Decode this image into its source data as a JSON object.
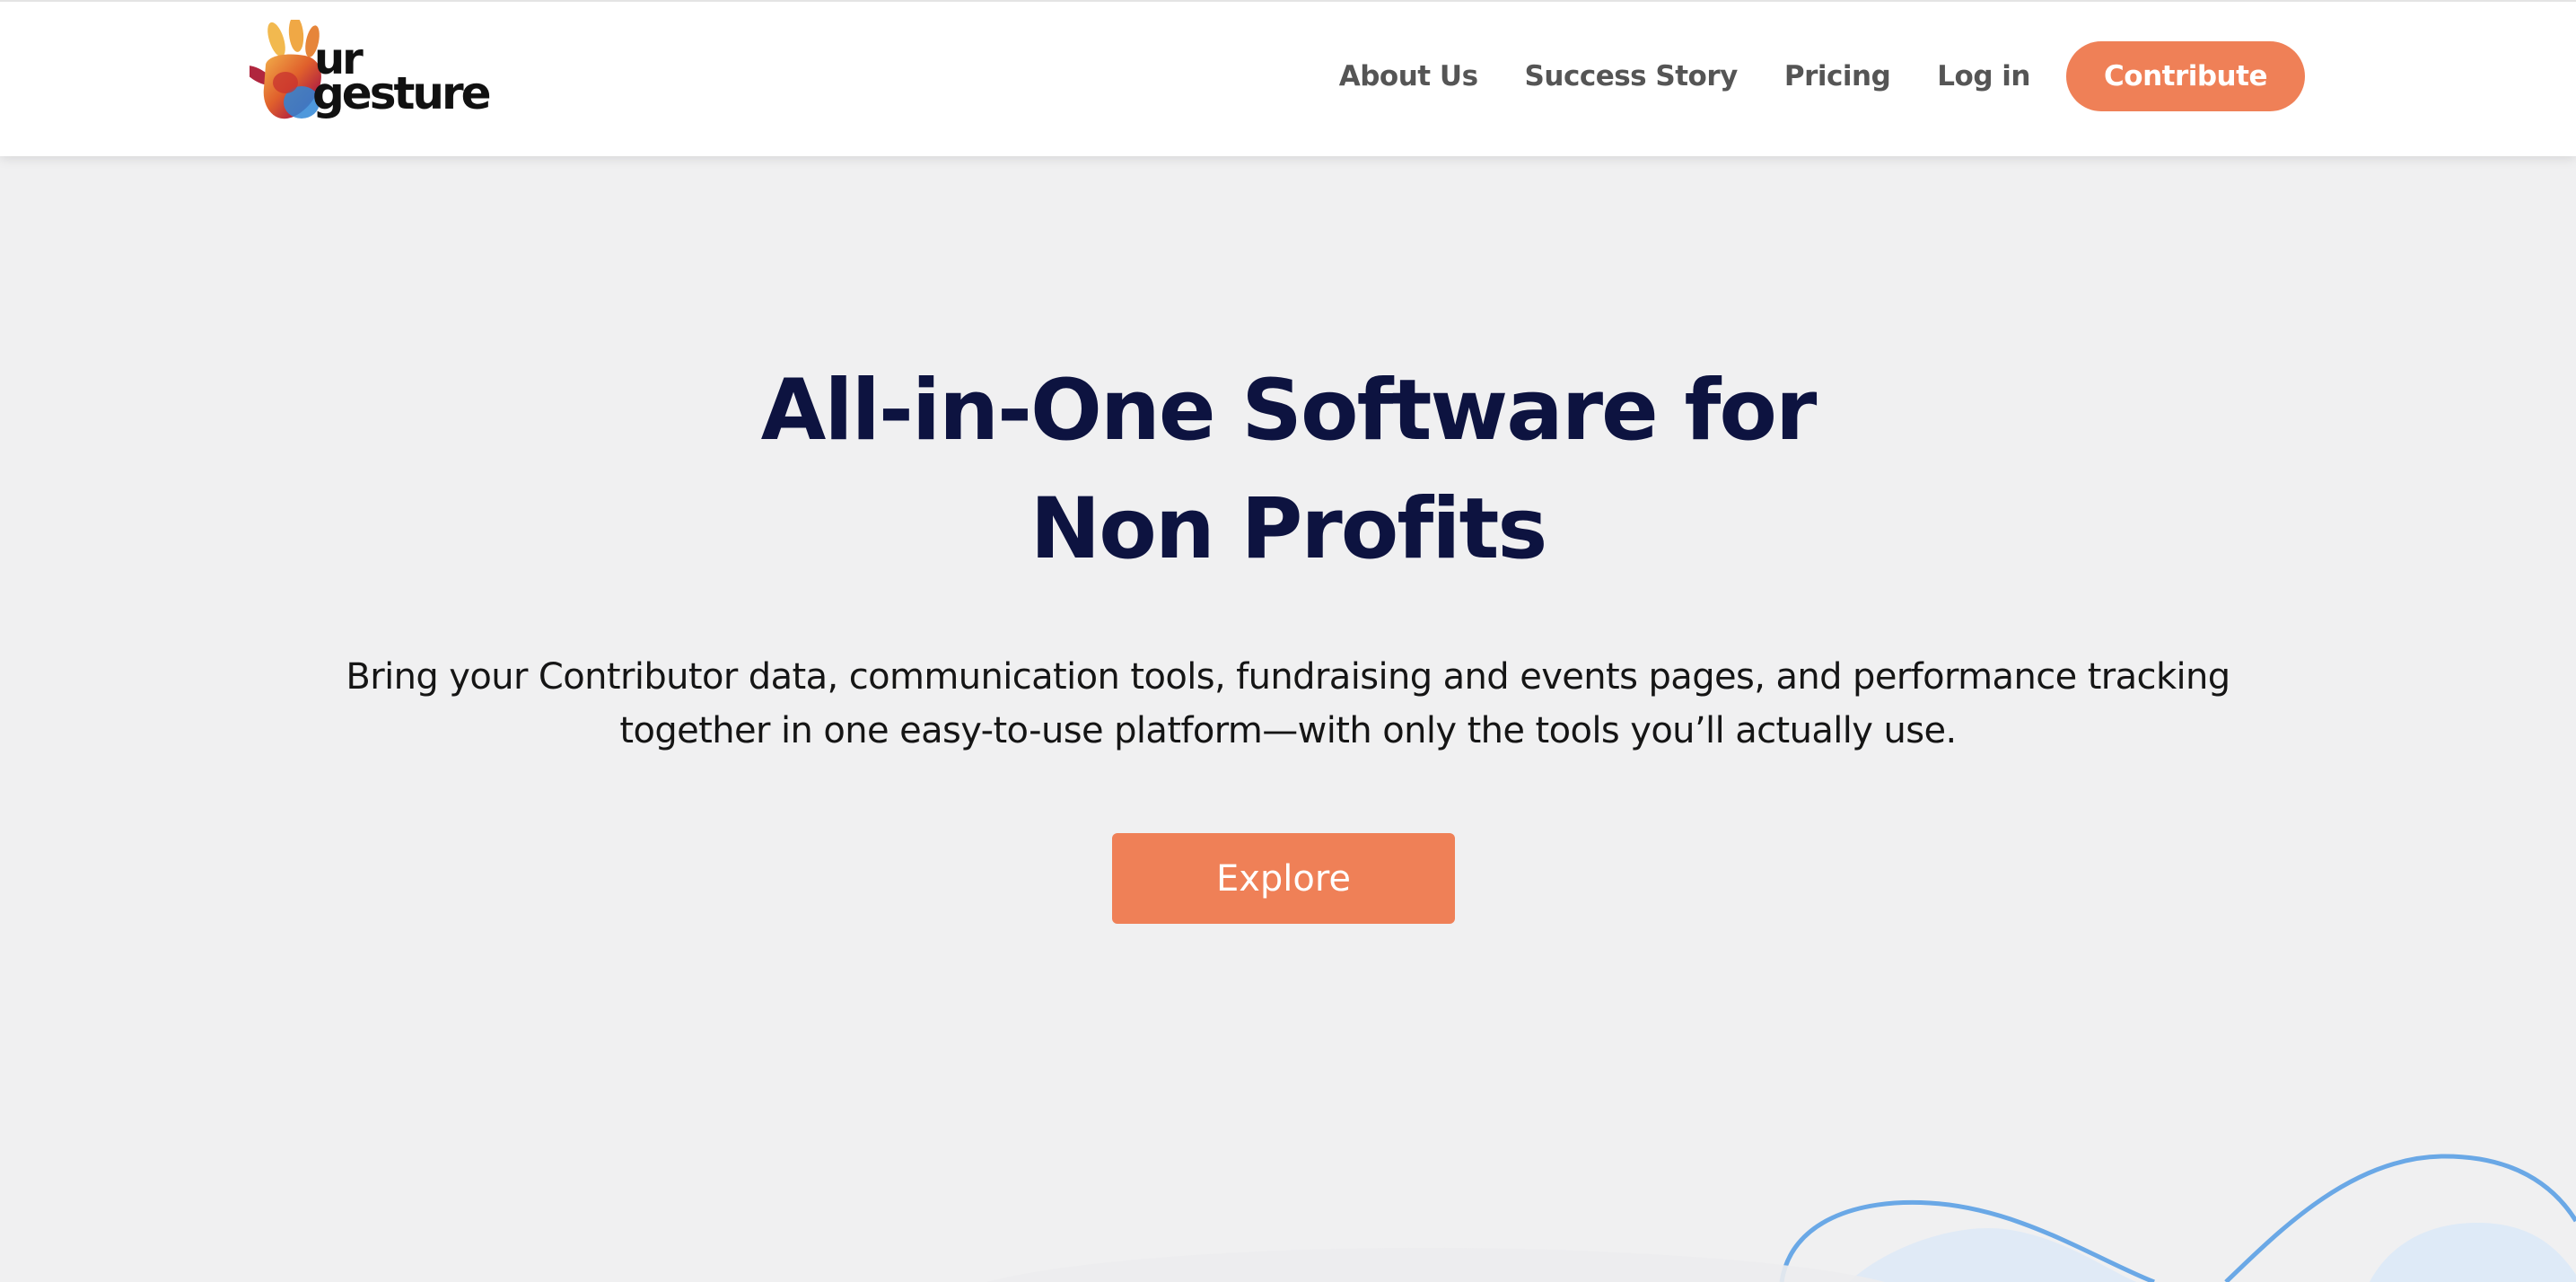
{
  "brand": {
    "logo_line1": "ur",
    "logo_line2": "gesture"
  },
  "nav": {
    "items": [
      {
        "label": "About Us"
      },
      {
        "label": "Success Story"
      },
      {
        "label": "Pricing"
      },
      {
        "label": "Log in"
      }
    ],
    "cta_label": "Contribute"
  },
  "hero": {
    "title_line1": "All-in-One Software for",
    "title_line2": "Non Profits",
    "subtitle_line1": "Bring your Contributor data, communication tools, fundraising and events pages, and performance tracking",
    "subtitle_line2": "together in one easy-to-use platform—with only the tools you’ll actually use.",
    "button_label": "Explore"
  },
  "colors": {
    "accent": "#ef8057",
    "heading": "#0d1340",
    "background": "#f0f0f1",
    "wave": "#6aa8e6"
  },
  "icons": {
    "logo": "hand-icon"
  }
}
